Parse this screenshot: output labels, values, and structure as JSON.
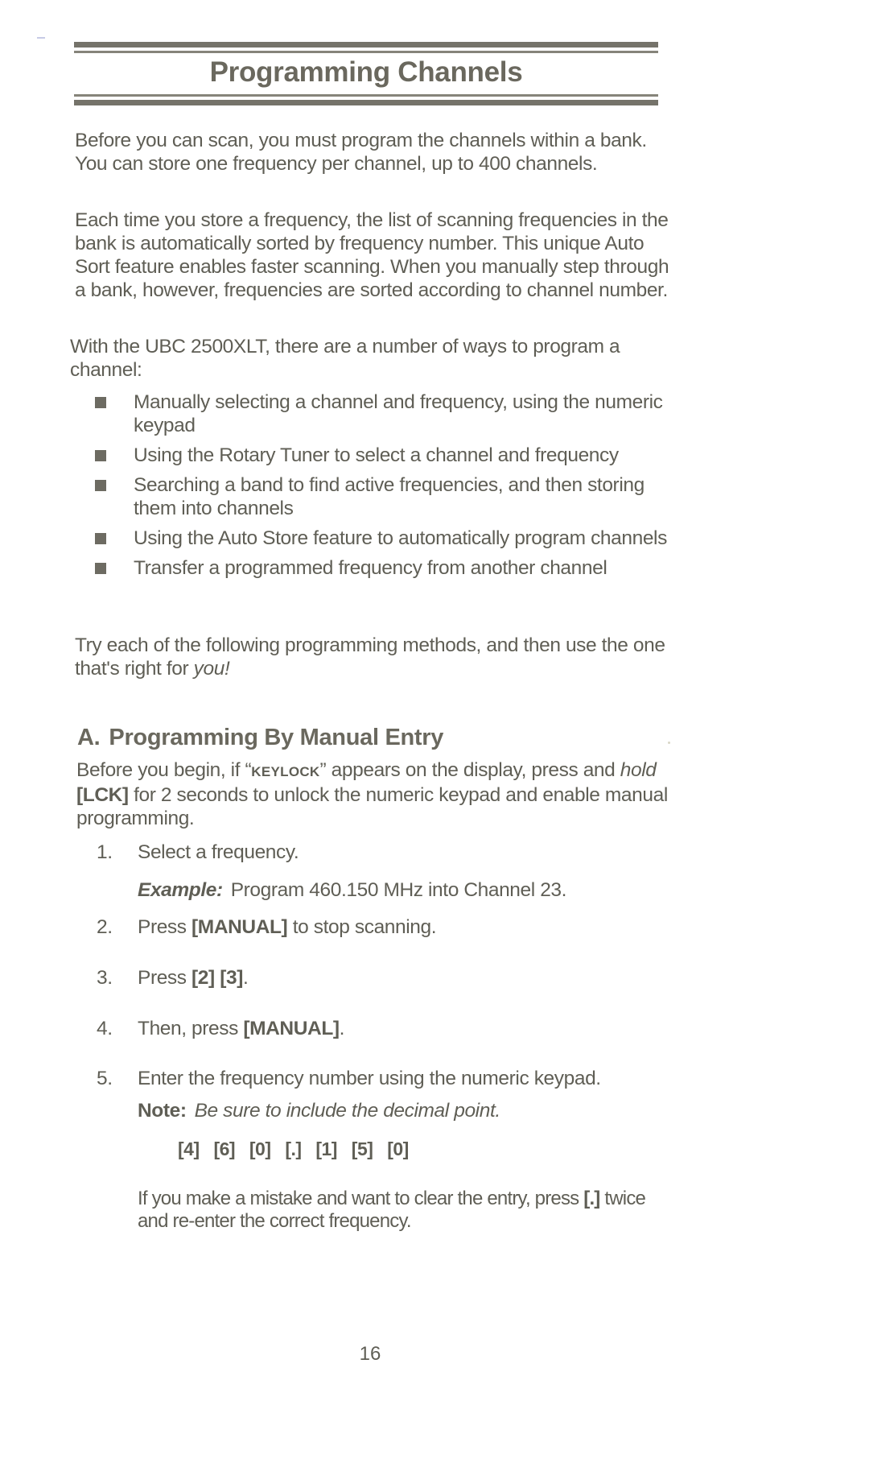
{
  "page": {
    "title": "Programming Channels",
    "page_number": "16",
    "text_color": "#5f5e55",
    "rule_color": "#75736a"
  },
  "intro": {
    "p1": "Before you can scan, you must program the channels within a bank. You can store one frequency per channel, up to 400 channels.",
    "p2": "Each time you store a frequency, the list of scanning frequencies in the bank is automatically sorted by frequency number.  This unique Auto Sort feature enables faster scanning.  When you manually step through a bank, however, frequencies are sorted according to channel number.",
    "p3": "With the UBC 2500XLT, there are a number of ways to program a channel:",
    "methods": [
      "Manually selecting a channel and frequency, using the numeric keypad",
      "Using the Rotary Tuner to select a channel and frequency",
      "Searching a band to find active frequencies, and then storing them into channels",
      "Using the Auto Store feature to automatically program channels",
      "Transfer a programmed frequency from another channel"
    ],
    "p4_main": "Try each of the following programming methods, and then use the one that's right for ",
    "p4_emphasis": "you!"
  },
  "section_a": {
    "letter": "A.",
    "heading": "Programming By Manual Entry",
    "intro_part1": "Before you begin, if “",
    "intro_keylock": "KEYLOCK",
    "intro_part2": "” appears on the display, press and ",
    "intro_hold": "hold",
    "intro_key": "[LCK]",
    "intro_part3": " for 2 seconds to unlock the numeric keypad and enable manual programming.",
    "steps": [
      {
        "num": "1.",
        "text": "Select a frequency."
      },
      {
        "num": "2.",
        "text_pre": "Press ",
        "key": "[MANUAL]",
        "text_post": " to stop scanning."
      },
      {
        "num": "3.",
        "text_pre": "Press ",
        "key1": "[2]",
        "key2": "[3]",
        "text_post": "."
      },
      {
        "num": "4.",
        "text_pre": "Then, press ",
        "key": "[MANUAL]",
        "text_post": "."
      },
      {
        "num": "5.",
        "text": "Enter the frequency number using the numeric keypad."
      }
    ],
    "example_label": "Example:",
    "example_text": "Program 460.150 MHz into Channel 23.",
    "note_label": "Note:",
    "note_text": "Be sure to include the decimal point.",
    "key_sequence": [
      "[4]",
      "[6]",
      "[0]",
      "[.]",
      "[1]",
      "[5]",
      "[0]"
    ],
    "hint_key": "[.]",
    "hint_pre": "If you make a mistake and want to clear the entry, press ",
    "hint_post": " twice and re-enter the correct frequency."
  }
}
